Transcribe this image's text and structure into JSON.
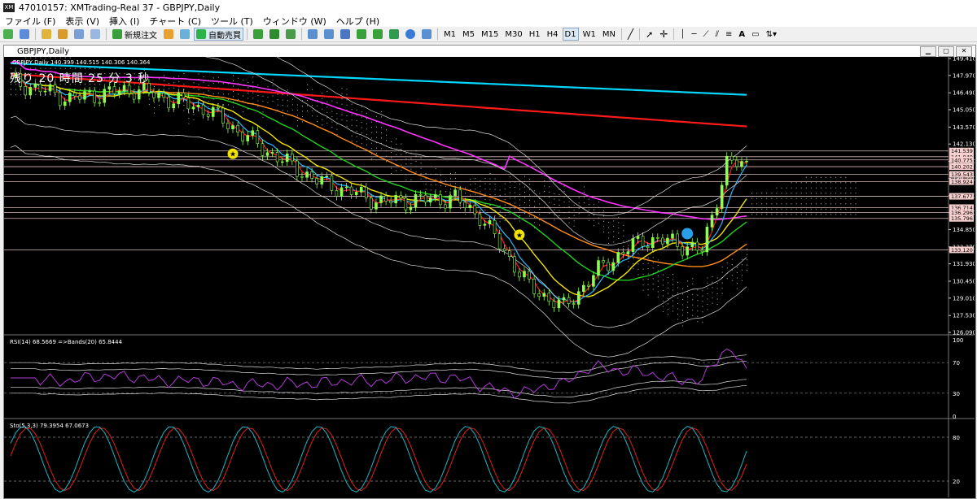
{
  "window": {
    "title": "47010157: XMTrading-Real 37 - GBPJPY,Daily"
  },
  "menu": [
    "ファイル (F)",
    "表示 (V)",
    "挿入 (I)",
    "チャート (C)",
    "ツール (T)",
    "ウィンドウ (W)",
    "ヘルプ (H)"
  ],
  "toolbar": {
    "new_order": "新規注文",
    "auto_trade": "自動売買",
    "timeframes": [
      "M1",
      "M5",
      "M15",
      "M30",
      "H1",
      "H4",
      "D1",
      "W1",
      "MN"
    ],
    "active_timeframe": "D1"
  },
  "chart": {
    "window_title": "GBPJPY,Daily",
    "ohlc_line": "GBPJPY,Daily  140.399 140.515 140.306 140.364",
    "timer": "残り 20 時間 25 分 3 秒",
    "price_labels": [
      "149.410",
      "147.970",
      "146.490",
      "145.050",
      "143.570",
      "142.130",
      "140.650",
      "139.210",
      "137.730",
      "136.290",
      "134.850",
      "133.370",
      "131.930",
      "130.450",
      "129.010",
      "127.530",
      "126.090"
    ],
    "highlight_labels": [
      {
        "text": "141.539",
        "color": "#f7d0d0"
      },
      {
        "text": "141.049",
        "color": "#f7d0d0"
      },
      {
        "text": "140.775",
        "color": "#f7d0d0"
      },
      {
        "text": "140.202",
        "color": "#f7d0d0"
      },
      {
        "text": "139.543",
        "color": "#f7d0d0"
      },
      {
        "text": "138.924",
        "color": "#f7d0d0"
      },
      {
        "text": "137.677",
        "color": "#f7d0d0"
      },
      {
        "text": "136.714",
        "color": "#f7d0d0"
      },
      {
        "text": "136.296",
        "color": "#f7d0d0"
      },
      {
        "text": "135.796",
        "color": "#f7d0d0"
      },
      {
        "text": "133.120",
        "color": "#f7d0d0"
      }
    ]
  },
  "rsi": {
    "label": "RSI(14) 68.5669  =>Bands(20) 65.8444",
    "levels": [
      "100",
      "70",
      "30",
      "0"
    ]
  },
  "sto": {
    "label": "Sto(5,3,3) 79.3954 67.0673",
    "levels": [
      "80",
      "20"
    ]
  },
  "colors": {
    "background": "#000000",
    "cyan_ma": "#00d8ff",
    "red_ma": "#ff1a1a",
    "magenta_ma": "#ff33ff",
    "orange_ma": "#ff8c1a",
    "yellow_ma": "#f2e600",
    "green_ma": "#1fd21f",
    "candles": "#8cff4d",
    "rsi_line": "#b03bd6",
    "sto_main": "#1fb5c4",
    "sto_signal": "#e02020"
  },
  "icons": [
    "new-chart-icon",
    "profiles-icon",
    "zoom-in-icon",
    "zoom-out-icon",
    "cursor-icon",
    "crosshair-icon",
    "trendline-icon",
    "text-icon",
    "label-icon"
  ]
}
